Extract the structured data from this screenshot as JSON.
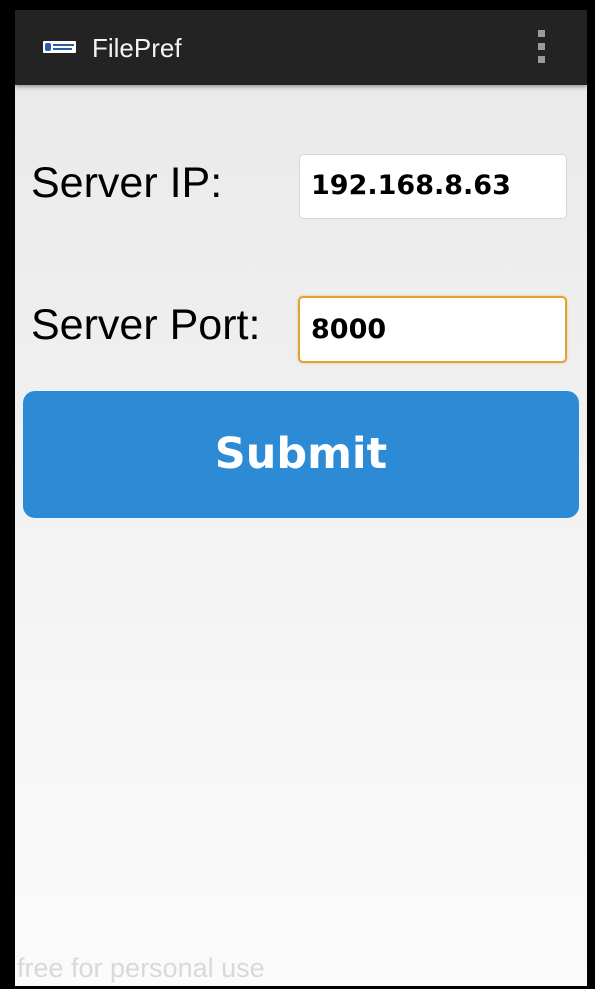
{
  "action_bar": {
    "title": "FilePref",
    "logo_icon": "app-logo-icon",
    "overflow_icon": "more-vert-icon",
    "background_color": "#232323"
  },
  "form": {
    "server_ip_label": "Server IP:",
    "server_ip_value": "192.168.8.63",
    "server_port_label": "Server Port:",
    "server_port_value": "8000",
    "focused_field": "server_port"
  },
  "submit_button": {
    "label": "Submit",
    "color": "#2d8bd6"
  },
  "colors": {
    "focus_border": "#e0a233"
  },
  "watermark": "free for personal use"
}
